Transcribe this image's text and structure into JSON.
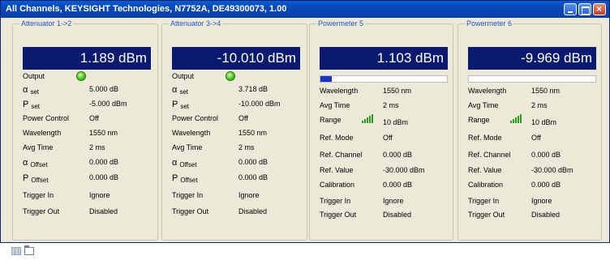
{
  "window": {
    "title": "All Channels,",
    "title_brand": "KEYSIGHT Technologies, N7752A, DE49300073, 1.00"
  },
  "panels": [
    {
      "title": "Attenuator 1->2",
      "display": "1.189 dBm",
      "output_label": "Output",
      "output_led": "on",
      "rows": [
        {
          "label": "set",
          "symbol": "α",
          "value": "5.000 dB"
        },
        {
          "label": "set",
          "symbol": "P",
          "value": "-5.000 dBm"
        },
        {
          "label": "Power Control",
          "value": "Off"
        },
        {
          "label": "Wavelength",
          "value": "1550 nm"
        },
        {
          "label": "Avg Time",
          "value": "2 ms"
        },
        {
          "label": "Offset",
          "symbol": "α",
          "value": "0.000 dB"
        },
        {
          "label": "Offset",
          "symbol": "P",
          "value": "0.000 dB"
        },
        {
          "label": "Trigger In",
          "value": "Ignore"
        },
        {
          "label": "Trigger Out",
          "value": "Disabled"
        }
      ]
    },
    {
      "title": "Attenuator 3->4",
      "display": "-10.010 dBm",
      "output_label": "Output",
      "output_led": "on",
      "rows": [
        {
          "label": "set",
          "symbol": "α",
          "value": "3.718 dB"
        },
        {
          "label": "set",
          "symbol": "P",
          "value": "-10.000 dBm"
        },
        {
          "label": "Power Control",
          "value": "Off"
        },
        {
          "label": "Wavelength",
          "value": "1550 nm"
        },
        {
          "label": "Avg Time",
          "value": "2 ms"
        },
        {
          "label": "Offset",
          "symbol": "α",
          "value": "0.000 dB"
        },
        {
          "label": "Offset",
          "symbol": "P",
          "value": "0.000 dB"
        },
        {
          "label": "Trigger In",
          "value": "Ignore"
        },
        {
          "label": "Trigger Out",
          "value": "Disabled"
        }
      ]
    },
    {
      "title": "Powermeter 5",
      "display": "1.103 dBm",
      "bar_fraction": 0.09,
      "rows": [
        {
          "label": "Wavelength",
          "value": "1550 nm"
        },
        {
          "label": "Avg Time",
          "value": "2 ms"
        },
        {
          "label": "Range",
          "value": "10 dBm",
          "icon": "signal-bars-icon"
        },
        {
          "label": "Ref. Mode",
          "value": "Off"
        },
        {
          "label": "Ref. Channel",
          "value": "0.000 dB"
        },
        {
          "label": "Ref. Value",
          "value": "-30.000 dBm"
        },
        {
          "label": "Calibration",
          "value": "0.000 dB"
        },
        {
          "label": "Trigger In",
          "value": "Ignore"
        },
        {
          "label": "Trigger Out",
          "value": "Disabled"
        }
      ]
    },
    {
      "title": "Powermeter 6",
      "display": "-9.969 dBm",
      "bar_fraction": 0.0,
      "rows": [
        {
          "label": "Wavelength",
          "value": "1550 nm"
        },
        {
          "label": "Avg Time",
          "value": "2 ms"
        },
        {
          "label": "Range",
          "value": "10 dBm",
          "icon": "signal-bars-icon"
        },
        {
          "label": "Ref. Mode",
          "value": "Off"
        },
        {
          "label": "Ref. Channel",
          "value": "0.000 dB"
        },
        {
          "label": "Ref. Value",
          "value": "-30.000 dBm"
        },
        {
          "label": "Calibration",
          "value": "0.000 dB"
        },
        {
          "label": "Trigger In",
          "value": "Ignore"
        },
        {
          "label": "Trigger Out",
          "value": "Disabled"
        }
      ]
    }
  ],
  "colors": {
    "display_bg": "#0a1a6e",
    "panel_title": "#2255cc",
    "led_on": "#3fc31a",
    "bar_fill": "#1a32c8"
  },
  "footer_icons": [
    "grid-view-icon",
    "folder-icon"
  ]
}
